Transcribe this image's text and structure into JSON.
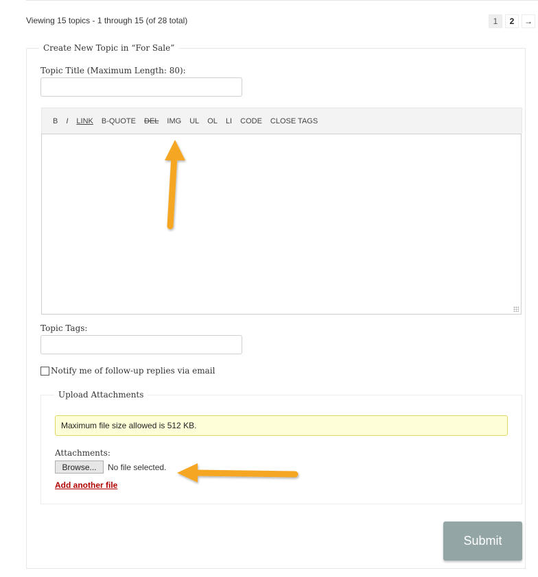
{
  "header": {
    "viewing_text": "Viewing 15 topics - 1 through 15 (of 28 total)",
    "pagination": [
      {
        "label": "1",
        "current": true
      },
      {
        "label": "2",
        "current": false
      },
      {
        "label": "→",
        "icon": "arrow-right-icon"
      }
    ]
  },
  "form": {
    "legend": "Create New Topic in “For Sale”",
    "title_label": "Topic Title (Maximum Length: 80):",
    "title_value": "",
    "toolbar": [
      "B",
      "I",
      "LINK",
      "B-QUOTE",
      "DEL",
      "IMG",
      "UL",
      "OL",
      "LI",
      "CODE",
      "CLOSE TAGS"
    ],
    "content_value": "",
    "tags_label": "Topic Tags:",
    "tags_value": "",
    "notify_label": "Notify me of follow-up replies via email",
    "notify_checked": false,
    "upload": {
      "legend": "Upload Attachments",
      "notice": "Maximum file size allowed is 512 KB.",
      "attachments_label": "Attachments:",
      "browse_label": "Browse...",
      "no_file_text": "No file selected.",
      "add_another_label": "Add another file"
    },
    "submit_label": "Submit"
  },
  "annotations": {
    "arrow_color": "#f5a623",
    "arrows": [
      "arrow-pointing-to-img-button",
      "arrow-pointing-to-browse-button"
    ]
  }
}
